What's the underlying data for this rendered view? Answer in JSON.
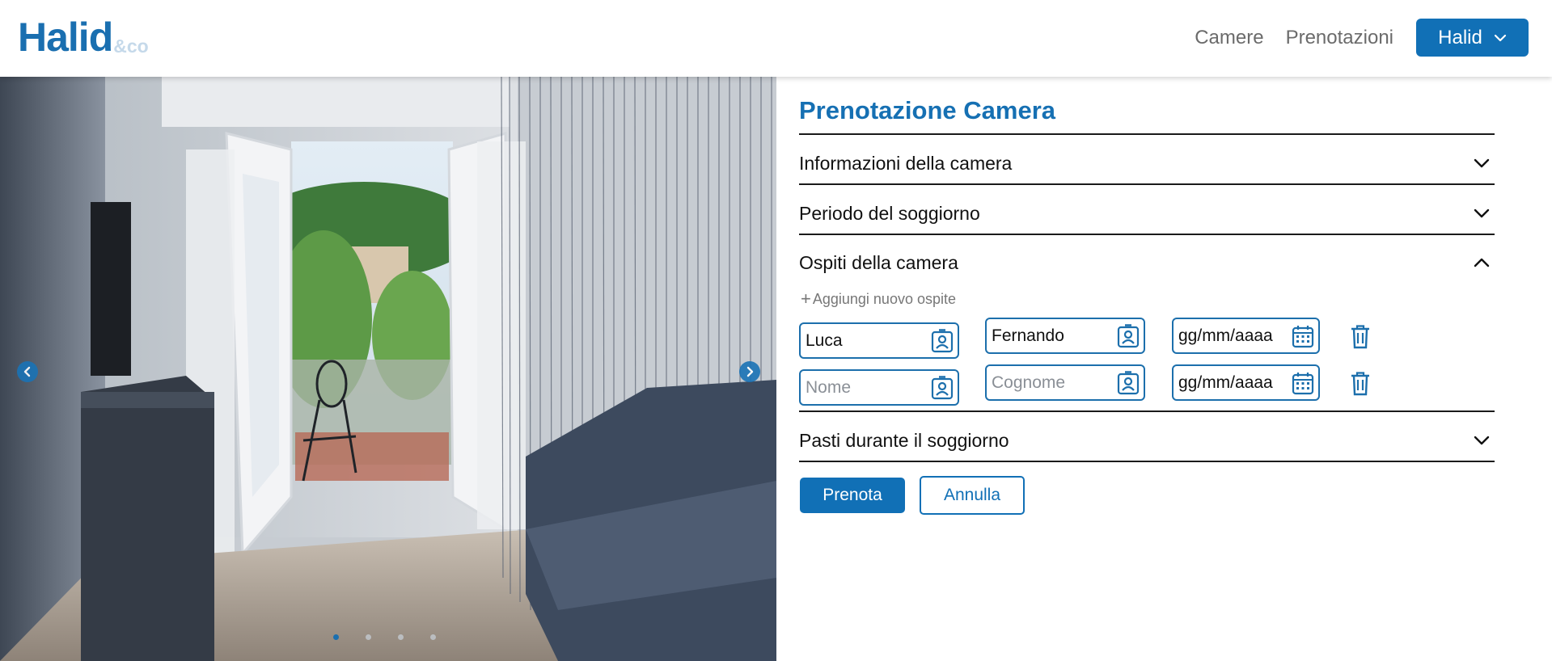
{
  "navbar": {
    "brand": "Halid",
    "brand_suffix": "&co",
    "links": [
      "Camere",
      "Prenotazioni"
    ],
    "user_label": "Halid"
  },
  "carousel": {
    "slide_count": 4,
    "active_slide": 1,
    "image_icon": "room-photo"
  },
  "booking": {
    "title": "Prenotazione Camera",
    "sections": {
      "room_info": "Informazioni della camera",
      "stay_period": "Periodo del soggiorno",
      "guests": "Ospiti della camera",
      "meals": "Pasti durante il soggiorno"
    },
    "add_guest_label": "Aggiungi nuovo ospite",
    "guests": [
      {
        "first_name": "Luca",
        "last_name": "Fernando",
        "birth_date": "gg/mm/aaaa"
      },
      {
        "first_name_placeholder": "Nome",
        "last_name_placeholder": "Cognome",
        "birth_date": "gg/mm/aaaa"
      }
    ],
    "submit_label": "Prenota",
    "cancel_label": "Annulla"
  },
  "colors": {
    "accent": "#1170b6",
    "title": "#1670b3",
    "brand_suffix": "#c5d9ea",
    "placeholder": "#8a8f96"
  }
}
